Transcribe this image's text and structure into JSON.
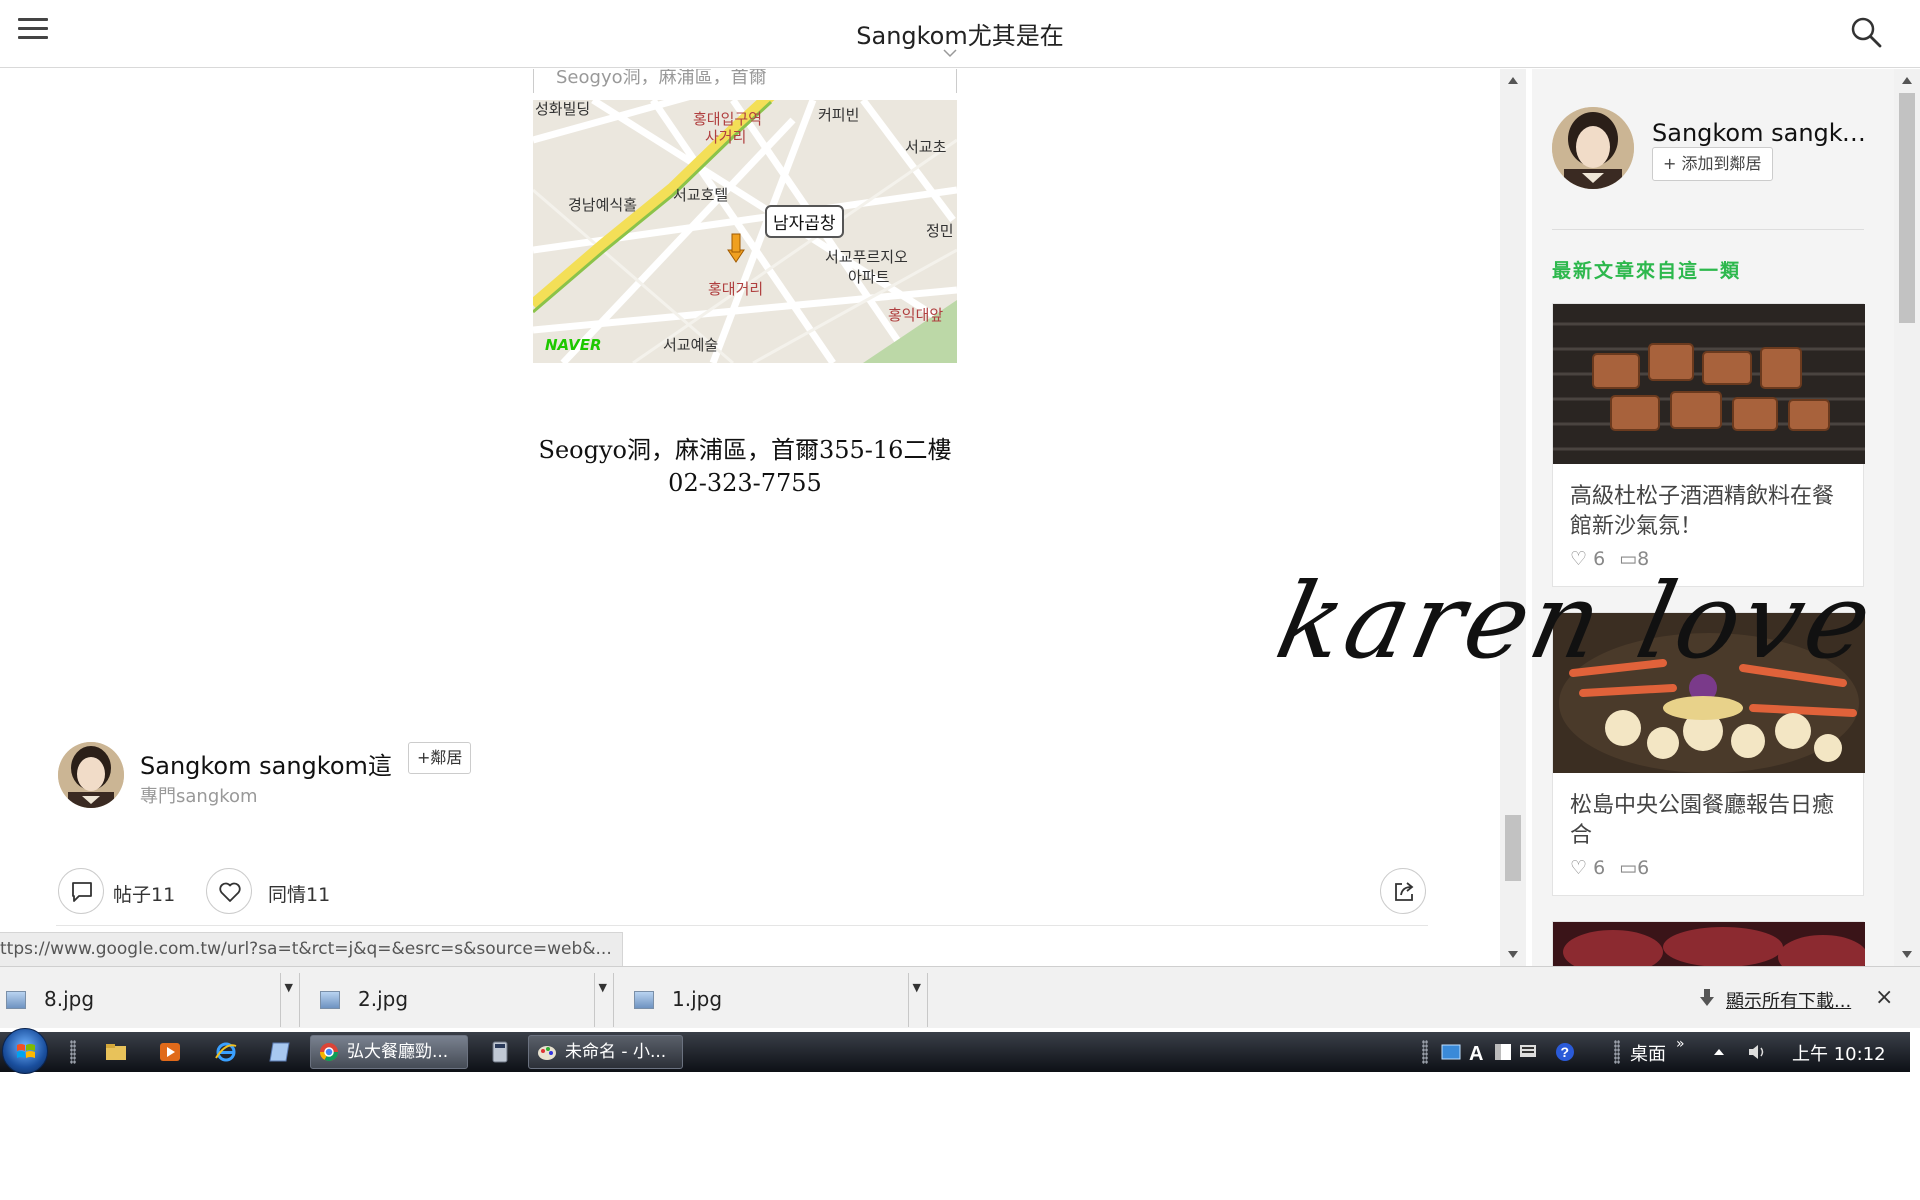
{
  "header": {
    "site_title": "Sangkom尤其是在"
  },
  "post": {
    "address_top": "Seogyo洞，麻浦區，首爾",
    "map": {
      "labels": [
        "성화빌딩",
        "홍대입구역",
        "사거리",
        "커피빈",
        "서교초",
        "서교호텔",
        "경남예식홀",
        "남자곱창",
        "정민",
        "서교푸르지오",
        "아파트",
        "홍대거리",
        "홍익대앞",
        "서교예술",
        "NAVER"
      ]
    },
    "address_line1": "Seogyo洞，麻浦區，首爾355-16二樓",
    "address_line2": "02-323-7755"
  },
  "author": {
    "name": "Sangkom sangkom這",
    "follow_label": "+鄰居",
    "desc": "專門sangkom"
  },
  "actions": {
    "comments_label": "帖子11",
    "likes_label": "同情11"
  },
  "status_url": "ttps://www.google.com.tw/url?sa=t&rct=j&q=&esrc=s&source=web&...",
  "sidebar": {
    "name": "Sangkom sangkom這",
    "follow_label": "+ 添加到鄰居",
    "heading": "最新文章來自這一類",
    "cards": [
      {
        "title": "高級杜松子酒酒精飲料在餐館新沙氣氛！",
        "likes": "♡ 6",
        "comments": "▭8"
      },
      {
        "title": "松島中央公園餐廳報告日癒合",
        "likes": "♡ 6",
        "comments": "▭6"
      }
    ]
  },
  "signature": "karen  love",
  "downloads": {
    "items": [
      {
        "name": "8.jpg"
      },
      {
        "name": "2.jpg"
      },
      {
        "name": "1.jpg"
      }
    ],
    "show_all": "顯示所有下載...",
    "close": "×"
  },
  "taskbar": {
    "tasks": [
      {
        "label": "弘大餐廳勁..."
      },
      {
        "label": "未命名 - 小..."
      }
    ],
    "desktop_label": "桌面",
    "clock": "上午 10:12"
  }
}
